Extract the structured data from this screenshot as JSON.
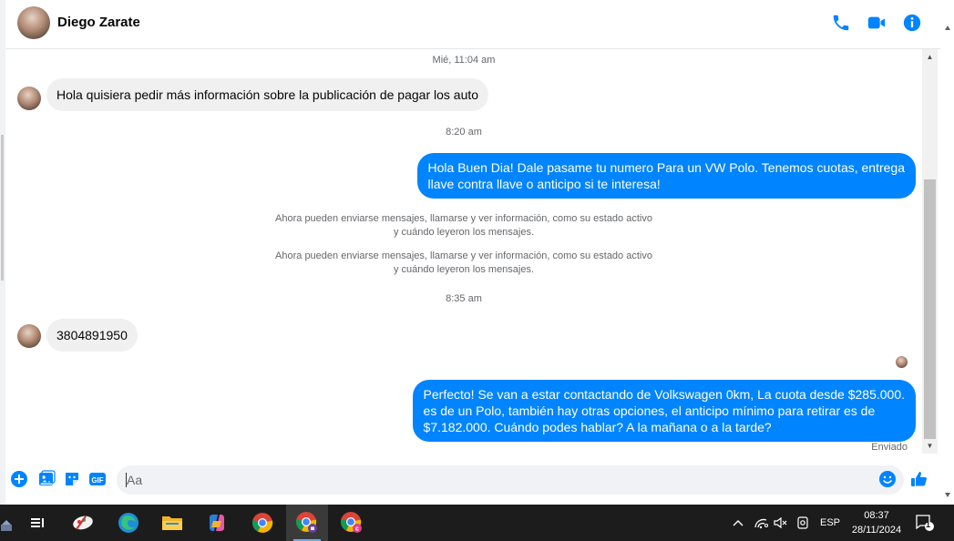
{
  "contact": {
    "name": "Diego Zarate"
  },
  "header": {
    "icons": [
      "phone-icon",
      "video-icon",
      "info-icon"
    ],
    "accent": "#0084ff"
  },
  "messages": {
    "ts1": "Mié, 11:04 am",
    "in1": "Hola quisiera pedir más información sobre la publicación de pagar los auto",
    "ts2": "8:20 am",
    "out1_l1": "Hola Buen Dia! Dale pasame tu numero Para un VW Polo. Tenemos cuotas, entrega",
    "out1_l2": "llave contra llave o anticipo si te interesa!",
    "sys1_l1": "Ahora pueden enviarse mensajes, llamarse y ver información, como su estado activo",
    "sys1_l2": "y cuándo leyeron los mensajes.",
    "sys2_l1": "Ahora pueden enviarse mensajes, llamarse y ver información, como su estado activo",
    "sys2_l2": "y cuándo leyeron los mensajes.",
    "ts3": "8:35 am",
    "in2": "3804891950",
    "out2_l1": "Perfecto!  Se van a estar contactando de Volkswagen 0km, La cuota desde $285.000.",
    "out2_l2": "es de un Polo, también hay otras opciones, el anticipo mínimo para retirar es de",
    "out2_l3": "$7.182.000. Cuándo podes hablar? A la mañana o a la tarde?",
    "status": "Enviado"
  },
  "composer": {
    "placeholder": "Aa",
    "gif_label": "GIF"
  },
  "taskbar": {
    "lang": "ESP",
    "time": "08:37",
    "date": "28/11/2024",
    "notifications": "1"
  }
}
